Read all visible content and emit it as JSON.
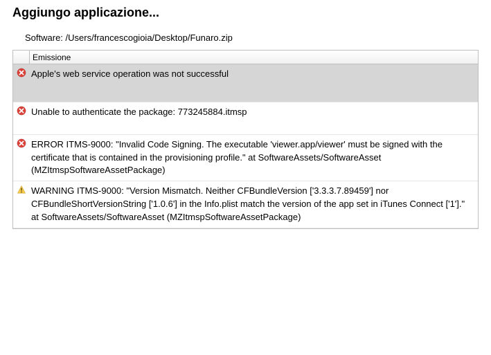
{
  "header": {
    "title": "Aggiungo applicazione...",
    "software_label": "Software:",
    "software_path": "/Users/francescogioia/Desktop/Funaro.zip"
  },
  "table": {
    "column_header": "Emissione",
    "rows": [
      {
        "type": "error",
        "selected": true,
        "message": "Apple's web service operation was not successful"
      },
      {
        "type": "error",
        "selected": false,
        "padded": true,
        "message": "Unable to authenticate the package: 773245884.itmsp"
      },
      {
        "type": "error",
        "selected": false,
        "message": "ERROR ITMS-9000: \"Invalid Code Signing. The executable 'viewer.app/viewer' must be signed with the certificate that is contained in the provisioning profile.\" at SoftwareAssets/SoftwareAsset (MZItmspSoftwareAssetPackage)"
      },
      {
        "type": "warning",
        "selected": false,
        "message": "WARNING ITMS-9000: \"Version Mismatch. Neither CFBundleVersion ['3.3.3.7.89459'] nor CFBundleShortVersionString ['1.0.6'] in the Info.plist match the version of the app set in iTunes Connect ['1'].\" at SoftwareAssets/SoftwareAsset (MZItmspSoftwareAssetPackage)"
      }
    ]
  }
}
